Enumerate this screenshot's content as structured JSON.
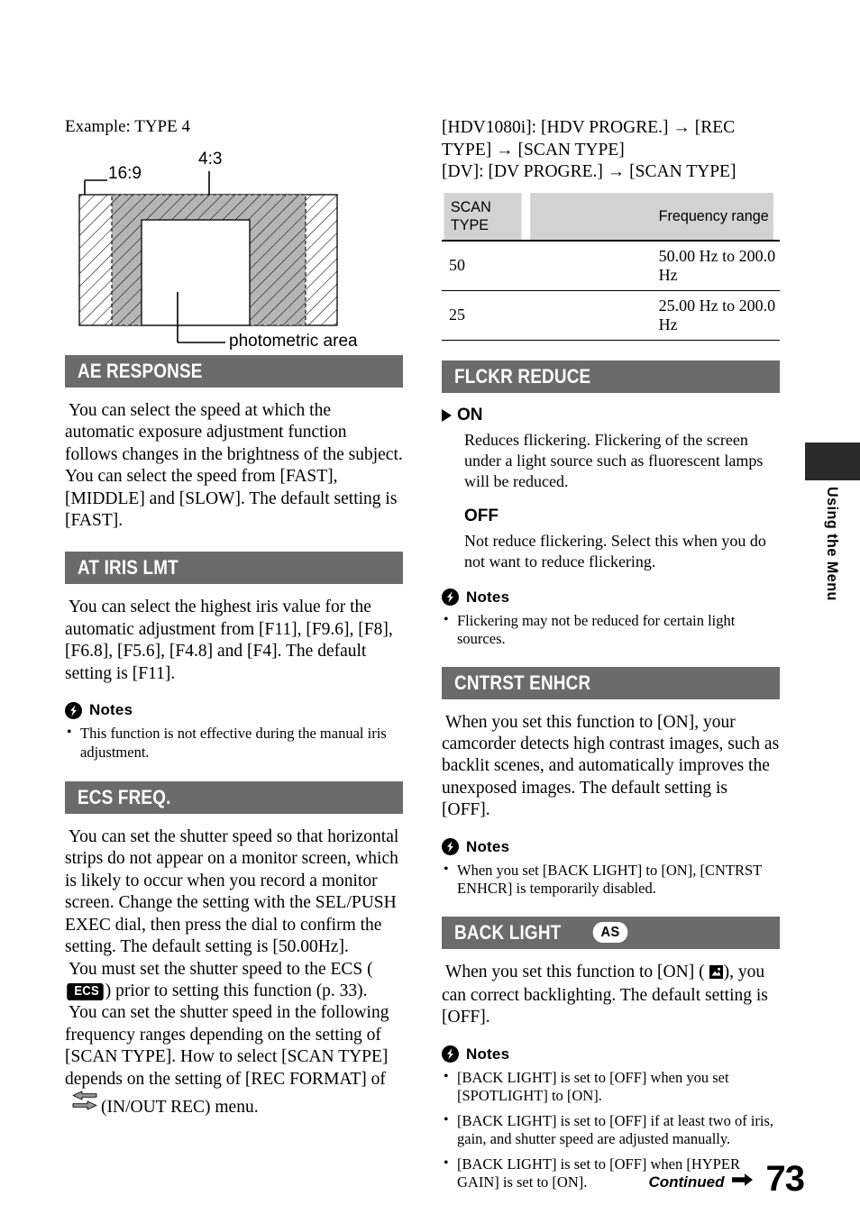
{
  "page": {
    "number": "73",
    "continued_label": "Continued",
    "side_tab_label": "Using the Menu"
  },
  "diagram": {
    "caption": "Example: TYPE 4",
    "label_16_9": "16:9",
    "label_4_3": "4:3",
    "label_photometric": "photometric area"
  },
  "left_column": {
    "sections": [
      {
        "id": "ae-response",
        "title": "AE RESPONSE",
        "paragraphs": [
          "You can select the speed at which the automatic exposure adjustment function follows changes in the brightness of the subject. You can select the speed from [FAST], [MIDDLE] and [SLOW]. The default setting is [FAST]."
        ]
      },
      {
        "id": "at-iris-lmt",
        "title": "AT IRIS LMT",
        "paragraphs": [
          "You can select the highest iris value for the automatic adjustment from [F11], [F9.6], [F8], [F6.8], [F5.6], [F4.8] and [F4]. The default setting is [F11]."
        ],
        "notes_label": "Notes",
        "notes": [
          "This function is not effective during the manual iris adjustment."
        ]
      },
      {
        "id": "ecs-freq",
        "title": "ECS FREQ.",
        "paragraph_1": "You can set the shutter speed so that horizontal strips do not appear on a monitor screen, which is likely to occur when you record a monitor screen. Change the setting with the SEL/PUSH EXEC dial, then press the dial to confirm the setting. The default setting is [50.00Hz].",
        "paragraph_2_a": "You must set the shutter speed to the ECS (",
        "paragraph_2_badge": "ECS",
        "paragraph_2_b": ") prior to setting this function (p. 33).",
        "paragraph_3_a": "You can set the shutter speed in the following frequency ranges depending on the setting of [SCAN TYPE]. How to select [SCAN TYPE] depends on the setting of [REC FORMAT] of",
        "paragraph_3_b": "(IN/OUT REC) menu."
      }
    ]
  },
  "right_column": {
    "intro_lines": [
      "[HDV1080i]: [HDV PROGRE.] → [REC TYPE] → [SCAN TYPE]",
      "[DV]: [DV PROGRE.] → [SCAN TYPE]"
    ],
    "table": {
      "headers": [
        "SCAN TYPE",
        "Frequency range"
      ],
      "rows": [
        [
          "50",
          "50.00 Hz to 200.0 Hz"
        ],
        [
          "25",
          "25.00 Hz to 200.0 Hz"
        ]
      ]
    },
    "sections": [
      {
        "id": "flckr-reduce",
        "title": "FLCKR REDUCE",
        "options": [
          {
            "label": "ON",
            "selected": true,
            "body": "Reduces flickering. Flickering of the screen under a light source such as fluorescent lamps will be reduced."
          },
          {
            "label": "OFF",
            "selected": false,
            "body": "Not reduce flickering. Select this when you do not want to reduce flickering."
          }
        ],
        "notes_label": "Notes",
        "notes": [
          "Flickering may not be reduced for certain light sources."
        ]
      },
      {
        "id": "cntrst-enhcr",
        "title": "CNTRST ENHCR",
        "paragraphs": [
          "When you set this function to [ON], your camcorder detects high contrast images, such as backlit scenes, and automatically improves the unexposed images. The default setting is [OFF]."
        ],
        "notes_label": "Notes",
        "notes": [
          "When you set [BACK LIGHT] to [ON], [CNTRST ENHCR] is temporarily disabled."
        ]
      },
      {
        "id": "back-light",
        "title": "BACK LIGHT",
        "badge": "AS",
        "paragraph_a": "When you set this function to [ON] (",
        "paragraph_b": "), you can correct backlighting. The default setting is [OFF].",
        "notes_label": "Notes",
        "notes": [
          "[BACK LIGHT] is set to [OFF] when you set [SPOTLIGHT] to [ON].",
          "[BACK LIGHT] is set to [OFF] if at least two of iris, gain, and shutter speed are adjusted manually.",
          "[BACK LIGHT] is set to [OFF] when [HYPER GAIN] is set to [ON]."
        ]
      }
    ]
  },
  "colors": {
    "heading_bar": "#6b6b6b",
    "table_header": "#d2d2d2",
    "side_tab": "#2b2b2b"
  }
}
